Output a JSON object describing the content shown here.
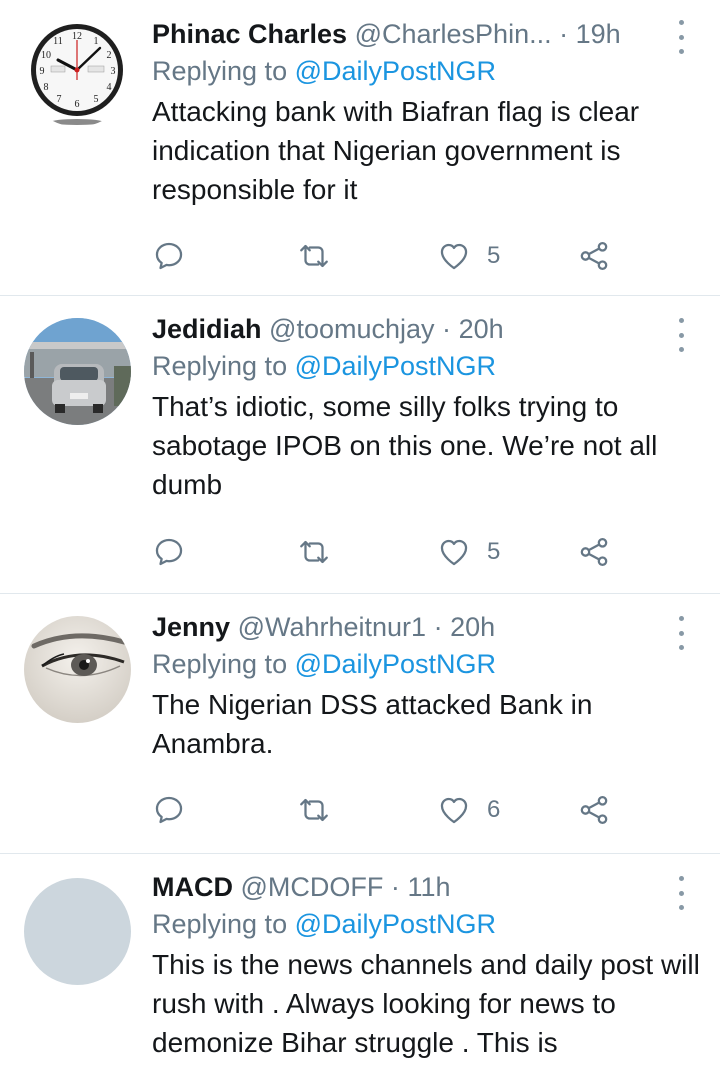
{
  "tweets": [
    {
      "name": "Phinac Charles",
      "handle": "@CharlesPhin...",
      "separator": "·",
      "time": "19h",
      "replying_prefix": "Replying to",
      "replying_to": "@DailyPostNGR",
      "text": "Attacking bank with  Biafran flag is clear indication that Nigerian government is responsible for it",
      "likes": "5",
      "avatar_icon": "wall-clock-avatar"
    },
    {
      "name": "Jedidiah",
      "handle": "@toomuchjay",
      "separator": "·",
      "time": "20h",
      "replying_prefix": "Replying to",
      "replying_to": "@DailyPostNGR",
      "text": "That’s idiotic, some silly folks trying to sabotage IPOB on this one. We’re not all dumb",
      "likes": "5",
      "avatar_icon": "car-photo-avatar"
    },
    {
      "name": "Jenny",
      "handle": "@Wahrheitnur1",
      "separator": "·",
      "time": "20h",
      "replying_prefix": "Replying to",
      "replying_to": "@DailyPostNGR",
      "text": "The Nigerian DSS attacked Bank in Anambra.",
      "likes": "6",
      "avatar_icon": "eye-photo-avatar"
    },
    {
      "name": "MACD",
      "handle": "@MCDOFF",
      "separator": "·",
      "time": "11h",
      "replying_prefix": "Replying to",
      "replying_to": "@DailyPostNGR",
      "text": "This is the news channels and daily post will rush with . Always looking for news to demonize Bihar struggle . This is",
      "avatar_icon": "default-avatar"
    }
  ],
  "colors": {
    "name": "#14171a",
    "meta": "#657786",
    "mention": "#1b95e0",
    "divider": "#e1e8ed",
    "icon": "#657786"
  }
}
